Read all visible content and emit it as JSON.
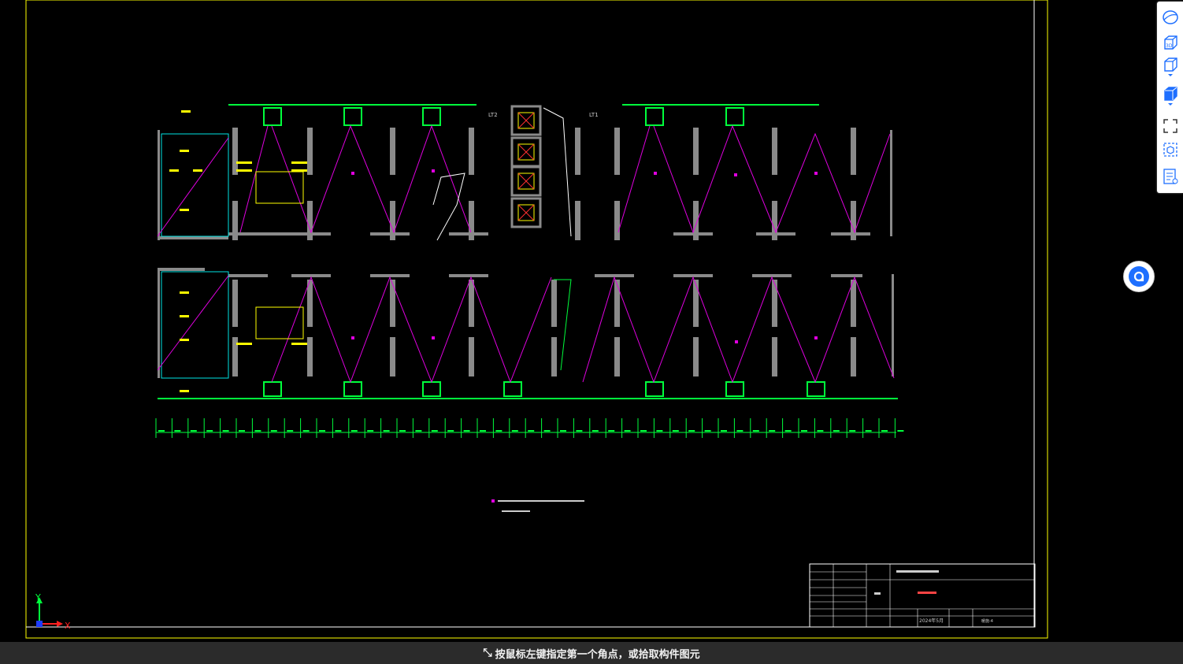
{
  "drawing": {
    "elevator_labels": [
      "LT2",
      "LT1"
    ],
    "title_block": {
      "date": "2024年5月",
      "sheet_no": "暖施-4"
    }
  },
  "toolbar": {
    "icons": [
      "view-sphere-icon",
      "view-3d-icon",
      "view-cube-icon",
      "view-cube-solid-icon",
      "fullscreen-icon",
      "model-check-icon",
      "property-list-icon"
    ],
    "view3d_label": "3D"
  },
  "status": {
    "prompt": "按鼠标左键指定第一个角点，或拾取构件图元"
  },
  "axis": {
    "x": "X",
    "y": "Y"
  },
  "colors": {
    "wall": "#8a8a8a",
    "window": "#00ff3c",
    "duct": "#e000e0",
    "annotation": "#ffff00",
    "cyan": "#00e5e5",
    "frame": "#ffff00"
  }
}
